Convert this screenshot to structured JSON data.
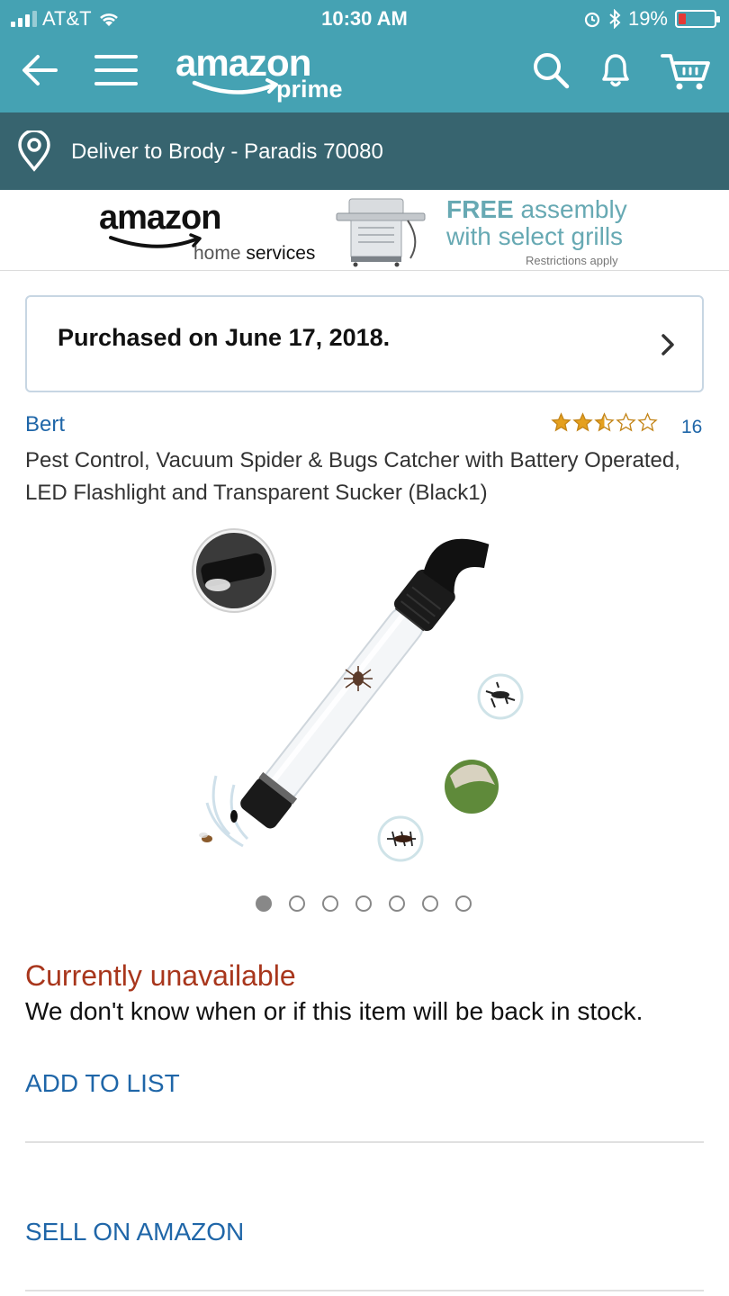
{
  "status_bar": {
    "carrier": "AT&T",
    "time": "10:30 AM",
    "battery": "19%"
  },
  "nav": {
    "logo_word": "amazon",
    "logo_prime": "prime",
    "icons": [
      "back-arrow-icon",
      "menu-icon",
      "search-icon",
      "bell-icon",
      "cart-icon"
    ]
  },
  "delivery": {
    "text": "Deliver to Brody - Paradis 70080"
  },
  "banner": {
    "brand_word": "amazon",
    "brand_sub_1": "home",
    "brand_sub_2": "services",
    "promo_bold": "FREE",
    "promo_line1_rest": " assembly",
    "promo_line2": "with select grills",
    "restrictions": "Restrictions apply"
  },
  "purchase": {
    "text": "Purchased on June 17, 2018."
  },
  "product": {
    "brand": "Bert",
    "rating": 2.5,
    "rating_max": 5,
    "review_count": "16",
    "title": "Pest Control, Vacuum Spider & Bugs Catcher with Battery Operated, LED Flashlight and Transparent Sucker (Black1)",
    "image_count": 7,
    "active_image": 1
  },
  "availability": {
    "status": "Currently unavailable",
    "message": "We don't know when or if this item will be back in stock."
  },
  "actions": {
    "add_to_list": "ADD TO LIST",
    "sell_on_amazon": "SELL ON AMAZON"
  },
  "colors": {
    "header": "#45a2b3",
    "delivery_bar": "#37646f",
    "link": "#1f66a8",
    "unavailable": "#a8361c",
    "star": "#e5a01e"
  }
}
